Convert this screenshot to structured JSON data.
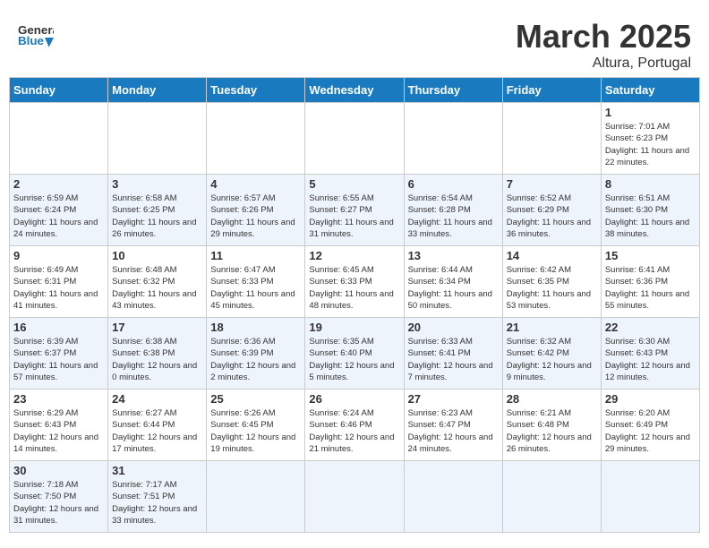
{
  "header": {
    "logo_general": "General",
    "logo_blue": "Blue",
    "month_title": "March 2025",
    "location": "Altura, Portugal"
  },
  "days_of_week": [
    "Sunday",
    "Monday",
    "Tuesday",
    "Wednesday",
    "Thursday",
    "Friday",
    "Saturday"
  ],
  "weeks": [
    {
      "cells": [
        {
          "day": "",
          "info": ""
        },
        {
          "day": "",
          "info": ""
        },
        {
          "day": "",
          "info": ""
        },
        {
          "day": "",
          "info": ""
        },
        {
          "day": "",
          "info": ""
        },
        {
          "day": "",
          "info": ""
        },
        {
          "day": "1",
          "info": "Sunrise: 7:01 AM\nSunset: 6:23 PM\nDaylight: 11 hours\nand 22 minutes."
        }
      ]
    },
    {
      "cells": [
        {
          "day": "2",
          "info": "Sunrise: 6:59 AM\nSunset: 6:24 PM\nDaylight: 11 hours\nand 24 minutes."
        },
        {
          "day": "3",
          "info": "Sunrise: 6:58 AM\nSunset: 6:25 PM\nDaylight: 11 hours\nand 26 minutes."
        },
        {
          "day": "4",
          "info": "Sunrise: 6:57 AM\nSunset: 6:26 PM\nDaylight: 11 hours\nand 29 minutes."
        },
        {
          "day": "5",
          "info": "Sunrise: 6:55 AM\nSunset: 6:27 PM\nDaylight: 11 hours\nand 31 minutes."
        },
        {
          "day": "6",
          "info": "Sunrise: 6:54 AM\nSunset: 6:28 PM\nDaylight: 11 hours\nand 33 minutes."
        },
        {
          "day": "7",
          "info": "Sunrise: 6:52 AM\nSunset: 6:29 PM\nDaylight: 11 hours\nand 36 minutes."
        },
        {
          "day": "8",
          "info": "Sunrise: 6:51 AM\nSunset: 6:30 PM\nDaylight: 11 hours\nand 38 minutes."
        }
      ]
    },
    {
      "cells": [
        {
          "day": "9",
          "info": "Sunrise: 6:49 AM\nSunset: 6:31 PM\nDaylight: 11 hours\nand 41 minutes."
        },
        {
          "day": "10",
          "info": "Sunrise: 6:48 AM\nSunset: 6:32 PM\nDaylight: 11 hours\nand 43 minutes."
        },
        {
          "day": "11",
          "info": "Sunrise: 6:47 AM\nSunset: 6:33 PM\nDaylight: 11 hours\nand 45 minutes."
        },
        {
          "day": "12",
          "info": "Sunrise: 6:45 AM\nSunset: 6:33 PM\nDaylight: 11 hours\nand 48 minutes."
        },
        {
          "day": "13",
          "info": "Sunrise: 6:44 AM\nSunset: 6:34 PM\nDaylight: 11 hours\nand 50 minutes."
        },
        {
          "day": "14",
          "info": "Sunrise: 6:42 AM\nSunset: 6:35 PM\nDaylight: 11 hours\nand 53 minutes."
        },
        {
          "day": "15",
          "info": "Sunrise: 6:41 AM\nSunset: 6:36 PM\nDaylight: 11 hours\nand 55 minutes."
        }
      ]
    },
    {
      "cells": [
        {
          "day": "16",
          "info": "Sunrise: 6:39 AM\nSunset: 6:37 PM\nDaylight: 11 hours\nand 57 minutes."
        },
        {
          "day": "17",
          "info": "Sunrise: 6:38 AM\nSunset: 6:38 PM\nDaylight: 12 hours\nand 0 minutes."
        },
        {
          "day": "18",
          "info": "Sunrise: 6:36 AM\nSunset: 6:39 PM\nDaylight: 12 hours\nand 2 minutes."
        },
        {
          "day": "19",
          "info": "Sunrise: 6:35 AM\nSunset: 6:40 PM\nDaylight: 12 hours\nand 5 minutes."
        },
        {
          "day": "20",
          "info": "Sunrise: 6:33 AM\nSunset: 6:41 PM\nDaylight: 12 hours\nand 7 minutes."
        },
        {
          "day": "21",
          "info": "Sunrise: 6:32 AM\nSunset: 6:42 PM\nDaylight: 12 hours\nand 9 minutes."
        },
        {
          "day": "22",
          "info": "Sunrise: 6:30 AM\nSunset: 6:43 PM\nDaylight: 12 hours\nand 12 minutes."
        }
      ]
    },
    {
      "cells": [
        {
          "day": "23",
          "info": "Sunrise: 6:29 AM\nSunset: 6:43 PM\nDaylight: 12 hours\nand 14 minutes."
        },
        {
          "day": "24",
          "info": "Sunrise: 6:27 AM\nSunset: 6:44 PM\nDaylight: 12 hours\nand 17 minutes."
        },
        {
          "day": "25",
          "info": "Sunrise: 6:26 AM\nSunset: 6:45 PM\nDaylight: 12 hours\nand 19 minutes."
        },
        {
          "day": "26",
          "info": "Sunrise: 6:24 AM\nSunset: 6:46 PM\nDaylight: 12 hours\nand 21 minutes."
        },
        {
          "day": "27",
          "info": "Sunrise: 6:23 AM\nSunset: 6:47 PM\nDaylight: 12 hours\nand 24 minutes."
        },
        {
          "day": "28",
          "info": "Sunrise: 6:21 AM\nSunset: 6:48 PM\nDaylight: 12 hours\nand 26 minutes."
        },
        {
          "day": "29",
          "info": "Sunrise: 6:20 AM\nSunset: 6:49 PM\nDaylight: 12 hours\nand 29 minutes."
        }
      ]
    },
    {
      "cells": [
        {
          "day": "30",
          "info": "Sunrise: 7:18 AM\nSunset: 7:50 PM\nDaylight: 12 hours\nand 31 minutes."
        },
        {
          "day": "31",
          "info": "Sunrise: 7:17 AM\nSunset: 7:51 PM\nDaylight: 12 hours\nand 33 minutes."
        },
        {
          "day": "",
          "info": ""
        },
        {
          "day": "",
          "info": ""
        },
        {
          "day": "",
          "info": ""
        },
        {
          "day": "",
          "info": ""
        },
        {
          "day": "",
          "info": ""
        }
      ]
    }
  ]
}
